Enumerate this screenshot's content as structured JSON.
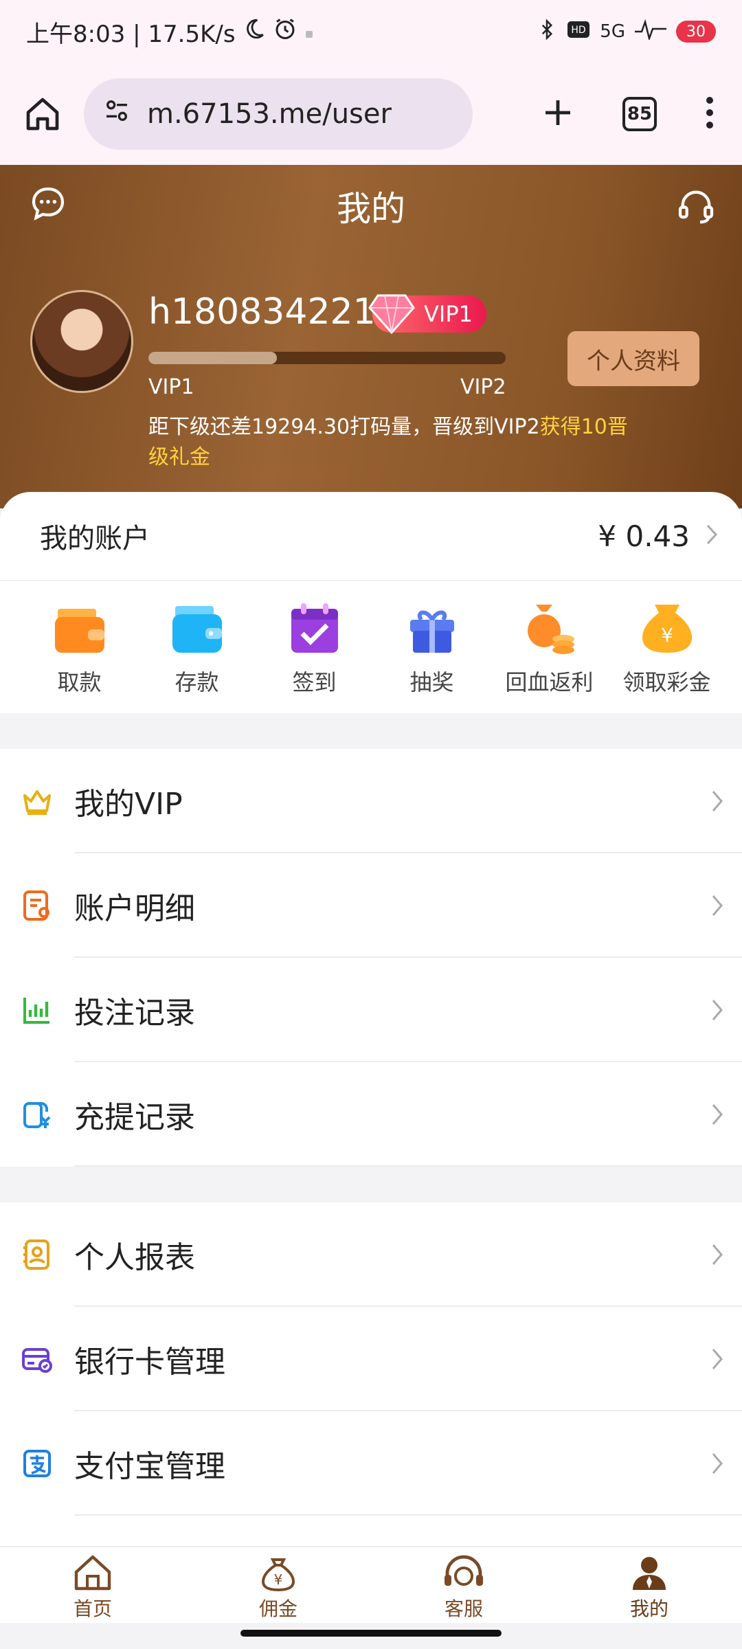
{
  "status_bar": {
    "time_speed": "上午8:03 | 17.5K/s",
    "network": "5G",
    "battery": "30"
  },
  "browser": {
    "url": "m.67153.me/user",
    "tab_count": "85"
  },
  "header": {
    "title": "我的",
    "username": "h1808342210",
    "vip_badge": "VIP1",
    "level_current": "VIP1",
    "level_next": "VIP2",
    "progress_fraction": 0.36,
    "profile_button": "个人资料",
    "upgrade_text": "距下级还差19294.30打码量，晋级到VIP2",
    "upgrade_highlight": "获得10晋级礼金"
  },
  "account": {
    "label": "我的账户",
    "amount": "¥ 0.43"
  },
  "quick_actions": [
    {
      "label": "取款",
      "icon": "wallet-orange-icon"
    },
    {
      "label": "存款",
      "icon": "wallet-blue-icon"
    },
    {
      "label": "签到",
      "icon": "calendar-check-icon"
    },
    {
      "label": "抽奖",
      "icon": "gift-icon"
    },
    {
      "label": "回血返利",
      "icon": "coins-bag-icon"
    },
    {
      "label": "领取彩金",
      "icon": "money-bag-icon"
    }
  ],
  "menu_group_1": [
    {
      "label": "我的VIP",
      "icon": "crown-icon",
      "color": "#e8b010"
    },
    {
      "label": "账户明细",
      "icon": "account-detail-icon",
      "color": "#ef6a1e"
    },
    {
      "label": "投注记录",
      "icon": "bar-chart-icon",
      "color": "#34b93c"
    },
    {
      "label": "充提记录",
      "icon": "recharge-icon",
      "color": "#1f8fe0"
    }
  ],
  "menu_group_2": [
    {
      "label": "个人报表",
      "icon": "report-icon",
      "color": "#e5a21a"
    },
    {
      "label": "银行卡管理",
      "icon": "bank-card-icon",
      "color": "#6a3fd4"
    },
    {
      "label": "支付宝管理",
      "icon": "alipay-icon",
      "color": "#1f7fe0"
    }
  ],
  "bottom_nav": [
    {
      "label": "首页",
      "icon": "home-icon"
    },
    {
      "label": "佣金",
      "icon": "commission-icon"
    },
    {
      "label": "客服",
      "icon": "headset-icon"
    },
    {
      "label": "我的",
      "icon": "user-icon"
    }
  ]
}
